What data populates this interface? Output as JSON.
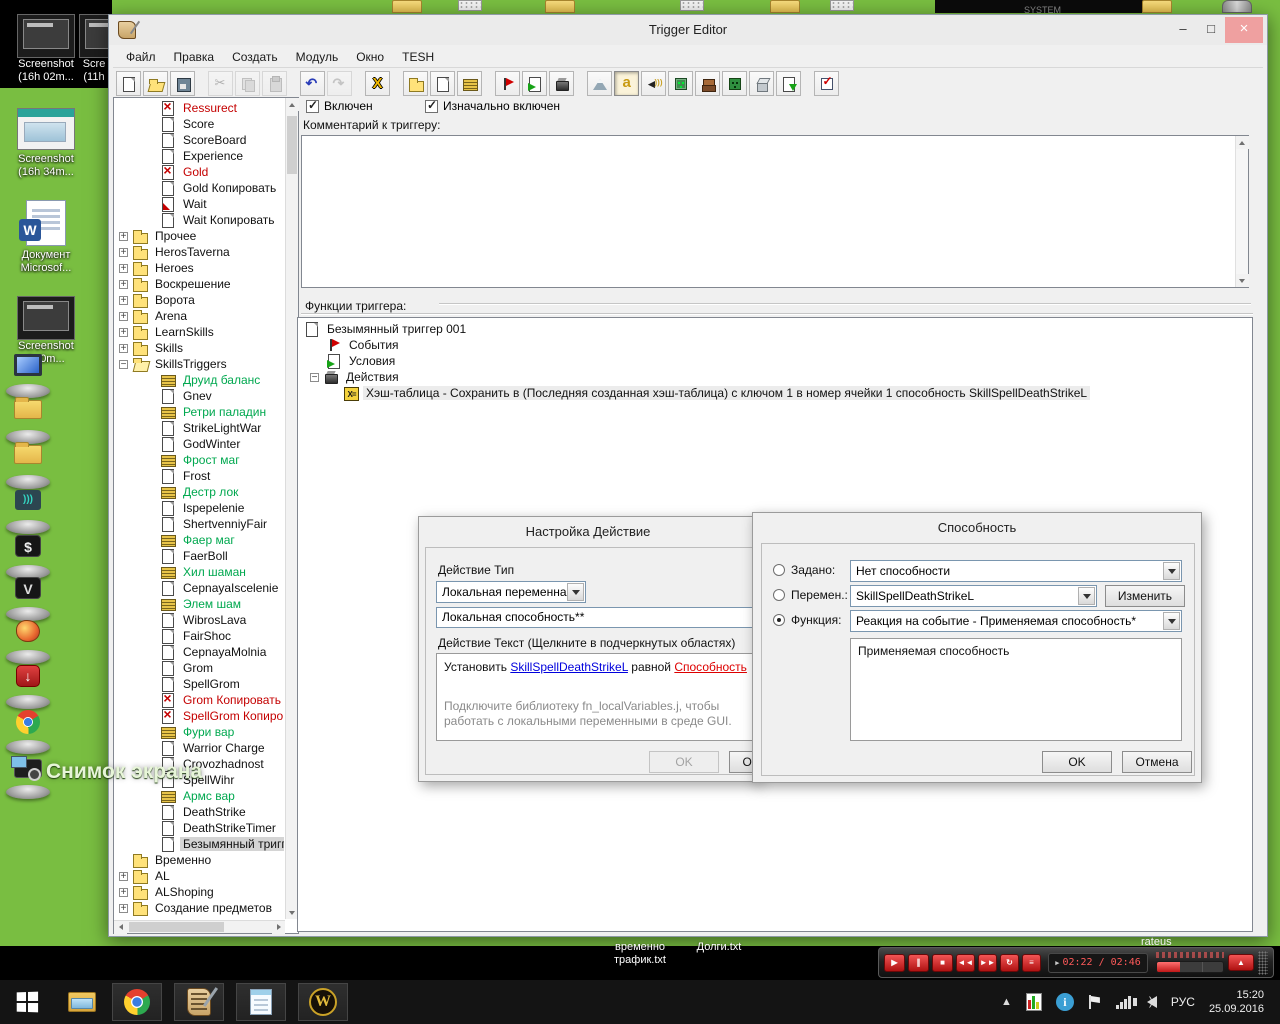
{
  "desktop": {
    "bg_color": "#79be41",
    "system_box_label": "SYSTEM",
    "capture_overlay_label": "Снимок экрана",
    "icons": [
      {
        "name": "screenshot-thumb-1",
        "label_line1": "Screenshot",
        "label_line2": "(16h 02m..."
      },
      {
        "name": "screenshot-thumb-2",
        "label_line1": "Scre",
        "label_line2": "(11h"
      },
      {
        "name": "screenshot-thumb-3",
        "label_line1": "Screenshot",
        "label_line2": "(16h 34m..."
      },
      {
        "name": "word-document",
        "label_line1": "Документ",
        "label_line2": "Microsof..."
      },
      {
        "name": "screenshot-thumb-4",
        "label_line1": "Screenshot",
        "label_line2": "(...0m..."
      }
    ],
    "pedestal_icons": [
      "this-pc",
      "folder-1",
      "folder-2",
      "network-app",
      "dollar-app",
      "v-app",
      "game-app",
      "downloads-app",
      "chrome-app",
      "screen-capture-app"
    ],
    "file_labels": [
      "временно трафик.txt",
      "Долги.txt"
    ]
  },
  "window": {
    "title": "Trigger Editor",
    "controls": {
      "minimize": "–",
      "maximize": "□",
      "close": "×"
    },
    "menus": [
      "Файл",
      "Правка",
      "Создать",
      "Модуль",
      "Окно",
      "TESH"
    ],
    "toolbar_groups": [
      [
        {
          "icon": "i-doc",
          "name": "new-file"
        },
        {
          "icon": "t-open",
          "name": "open"
        },
        {
          "icon": "t-save",
          "name": "save"
        }
      ],
      [
        {
          "icon": "t-cut",
          "name": "cut",
          "disabled": true
        },
        {
          "icon": "t-copy",
          "name": "copy",
          "disabled": true
        },
        {
          "icon": "t-paste",
          "name": "paste",
          "disabled": true
        }
      ],
      [
        {
          "icon": "t-undo",
          "name": "undo"
        },
        {
          "icon": "t-redo",
          "name": "redo",
          "disabled": true
        }
      ],
      [
        {
          "icon": "t-varx",
          "name": "variables"
        }
      ],
      [
        {
          "icon": "i-folder",
          "name": "new-category"
        },
        {
          "icon": "i-doc",
          "name": "new-trigger"
        },
        {
          "icon": "i-comment",
          "name": "new-comment"
        }
      ],
      [
        {
          "icon": "i-flag",
          "name": "new-event"
        },
        {
          "icon": "i-cond",
          "name": "new-condition"
        },
        {
          "icon": "i-action",
          "name": "new-action"
        }
      ],
      [
        {
          "icon": "t-terr",
          "name": "terrain-editor"
        },
        {
          "icon": "t-texta",
          "name": "trigger-editor",
          "pressed": true
        },
        {
          "icon": "t-sound",
          "name": "sound-editor"
        },
        {
          "icon": "t-objed",
          "name": "object-editor"
        },
        {
          "icon": "t-camped",
          "name": "campaign-editor"
        },
        {
          "icon": "t-aied",
          "name": "ai-editor"
        },
        {
          "icon": "t-cube",
          "name": "object-manager"
        },
        {
          "icon": "t-import",
          "name": "import-manager"
        }
      ],
      [
        {
          "icon": "t-modcheck",
          "name": "module-settings"
        }
      ]
    ],
    "enabled_checkbox": {
      "label": "Включен",
      "checked": true
    },
    "initially_on_checkbox": {
      "label": "Изначально включен",
      "checked": true
    },
    "comment_label": "Комментарий к триггеру:",
    "comment_text": "",
    "functions_label": "Функции триггера:",
    "tree_items": [
      {
        "indent": 2,
        "icon": "i-doc-x",
        "label": "Ressurect",
        "color": "red"
      },
      {
        "indent": 2,
        "icon": "i-doc",
        "label": "Score"
      },
      {
        "indent": 2,
        "icon": "i-doc",
        "label": "ScoreBoard"
      },
      {
        "indent": 2,
        "icon": "i-doc",
        "label": "Experience"
      },
      {
        "indent": 2,
        "icon": "i-doc-x",
        "label": "Gold",
        "color": "red"
      },
      {
        "indent": 2,
        "icon": "i-doc",
        "label": "Gold Копировать"
      },
      {
        "indent": 2,
        "icon": "i-doc-wait",
        "label": "Wait"
      },
      {
        "indent": 2,
        "icon": "i-doc",
        "label": "Wait Копировать"
      },
      {
        "indent": 1,
        "exp": "+",
        "icon": "i-folder",
        "label": "Прочее"
      },
      {
        "indent": 1,
        "exp": "+",
        "icon": "i-folder",
        "label": "HerosTaverna"
      },
      {
        "indent": 1,
        "exp": "+",
        "icon": "i-folder",
        "label": "Heroes"
      },
      {
        "indent": 1,
        "exp": "+",
        "icon": "i-folder",
        "label": "Воскрешение"
      },
      {
        "indent": 1,
        "exp": "+",
        "icon": "i-folder",
        "label": "Ворота"
      },
      {
        "indent": 1,
        "exp": "+",
        "icon": "i-folder",
        "label": "Arena"
      },
      {
        "indent": 1,
        "exp": "+",
        "icon": "i-folder",
        "label": "LearnSkills"
      },
      {
        "indent": 1,
        "exp": "+",
        "icon": "i-folder",
        "label": "Skills"
      },
      {
        "indent": 1,
        "exp": "-",
        "icon": "i-folder-open",
        "label": "SkillsTriggers"
      },
      {
        "indent": 2,
        "icon": "i-comment",
        "label": "Друид баланс",
        "color": "green"
      },
      {
        "indent": 2,
        "icon": "i-doc",
        "label": "Gnev"
      },
      {
        "indent": 2,
        "icon": "i-comment",
        "label": "Ретри паладин",
        "color": "green"
      },
      {
        "indent": 2,
        "icon": "i-doc",
        "label": "StrikeLightWar"
      },
      {
        "indent": 2,
        "icon": "i-doc",
        "label": "GodWinter"
      },
      {
        "indent": 2,
        "icon": "i-comment",
        "label": "Фрост маг",
        "color": "green"
      },
      {
        "indent": 2,
        "icon": "i-doc",
        "label": "Frost"
      },
      {
        "indent": 2,
        "icon": "i-comment",
        "label": "Дестр лок",
        "color": "green"
      },
      {
        "indent": 2,
        "icon": "i-doc",
        "label": "Ispepelenie"
      },
      {
        "indent": 2,
        "icon": "i-doc",
        "label": "ShertvenniyFair"
      },
      {
        "indent": 2,
        "icon": "i-comment",
        "label": "Фаер маг",
        "color": "green"
      },
      {
        "indent": 2,
        "icon": "i-doc",
        "label": "FaerBoll"
      },
      {
        "indent": 2,
        "icon": "i-comment",
        "label": "Хил шаман",
        "color": "green"
      },
      {
        "indent": 2,
        "icon": "i-doc",
        "label": "CepnayaIscelenie"
      },
      {
        "indent": 2,
        "icon": "i-comment",
        "label": "Элем шам",
        "color": "green"
      },
      {
        "indent": 2,
        "icon": "i-doc",
        "label": "WibrosLava"
      },
      {
        "indent": 2,
        "icon": "i-doc",
        "label": "FairShoc"
      },
      {
        "indent": 2,
        "icon": "i-doc",
        "label": "CepnayaMolnia"
      },
      {
        "indent": 2,
        "icon": "i-doc",
        "label": "Grom"
      },
      {
        "indent": 2,
        "icon": "i-doc",
        "label": "SpellGrom"
      },
      {
        "indent": 2,
        "icon": "i-doc-x",
        "label": "Grom Копировать",
        "color": "red"
      },
      {
        "indent": 2,
        "icon": "i-doc-x",
        "label": "SpellGrom Копироват",
        "color": "red"
      },
      {
        "indent": 2,
        "icon": "i-comment",
        "label": "Фури вар",
        "color": "green"
      },
      {
        "indent": 2,
        "icon": "i-doc",
        "label": "Warrior Charge"
      },
      {
        "indent": 2,
        "icon": "i-doc",
        "label": "Crovozhadnost"
      },
      {
        "indent": 2,
        "icon": "i-doc",
        "label": "SpellWihr"
      },
      {
        "indent": 2,
        "icon": "i-comment",
        "label": "Армс вар",
        "color": "green"
      },
      {
        "indent": 2,
        "icon": "i-doc",
        "label": "DeathStrike"
      },
      {
        "indent": 2,
        "icon": "i-doc",
        "label": "DeathStrikeTimer"
      },
      {
        "indent": 2,
        "icon": "i-doc",
        "label": "Безымянный тригге",
        "selected": true
      },
      {
        "indent": 1,
        "icon": "i-folder",
        "label": "Временно"
      },
      {
        "indent": 1,
        "exp": "+",
        "icon": "i-folder",
        "label": "AL"
      },
      {
        "indent": 1,
        "exp": "+",
        "icon": "i-folder",
        "label": "ALShoping"
      },
      {
        "indent": 1,
        "exp": "+",
        "icon": "i-folder",
        "label": "Создание предметов"
      }
    ],
    "function_items": [
      {
        "sp": 4,
        "icon": "i-doc",
        "label": "Безымянный триггер 001"
      },
      {
        "sp": 26,
        "icon": "i-flag",
        "label": "События"
      },
      {
        "sp": 26,
        "icon": "i-cond",
        "label": "Условия"
      },
      {
        "sp": 10,
        "exp": "-",
        "icon": "i-action",
        "label": "Действия"
      },
      {
        "sp": 44,
        "icon": "i-hash",
        "label": "Хэш-таблица - Сохранить в (Последняя созданная хэш-таблица) с ключом 1 в номер ячейки 1 способность SkillSpellDeathStrikeL",
        "highlight": true
      }
    ]
  },
  "action_dialog": {
    "title": "Настройка Действие",
    "type_label": "Действие Тип",
    "type_value": "Локальная переменная",
    "subtype_value": "Локальная способность**",
    "text_label": "Действие Текст (Щелкните в подчеркнутых областях)",
    "text_parts": [
      {
        "text": "Установить ",
        "kind": "plain"
      },
      {
        "text": "SkillSpellDeathStrikeL",
        "kind": "link-blue"
      },
      {
        "text": " равной ",
        "kind": "plain"
      },
      {
        "text": "Способность",
        "kind": "link-red"
      }
    ],
    "note": "Подключите библиотеку fn_localVariables.j, чтобы работать с локальными переменными в среде GUI.",
    "ok_label": "OK",
    "cancel_label": "Отмена"
  },
  "ability_dialog": {
    "title": "Способность",
    "preset": {
      "label": "Задано:",
      "value": "Нет способности",
      "selected": false
    },
    "variable": {
      "label": "Перемен.:",
      "value": "SkillSpellDeathStrikeL",
      "selected": false,
      "button_label": "Изменить"
    },
    "function": {
      "label": "Функция:",
      "value": "Реакция на событие - Применяемая способность*",
      "selected": true
    },
    "description": "Применяемая способность",
    "ok_label": "OK",
    "cancel_label": "Отмена"
  },
  "player": {
    "label_above": "rateus",
    "lcd_prefix": "▶",
    "display": "02:22 / 02:46",
    "progress_pct": 35
  },
  "taskbar": {
    "tray": {
      "lang": "РУС",
      "time": "15:20",
      "date": "25.09.2016"
    }
  }
}
